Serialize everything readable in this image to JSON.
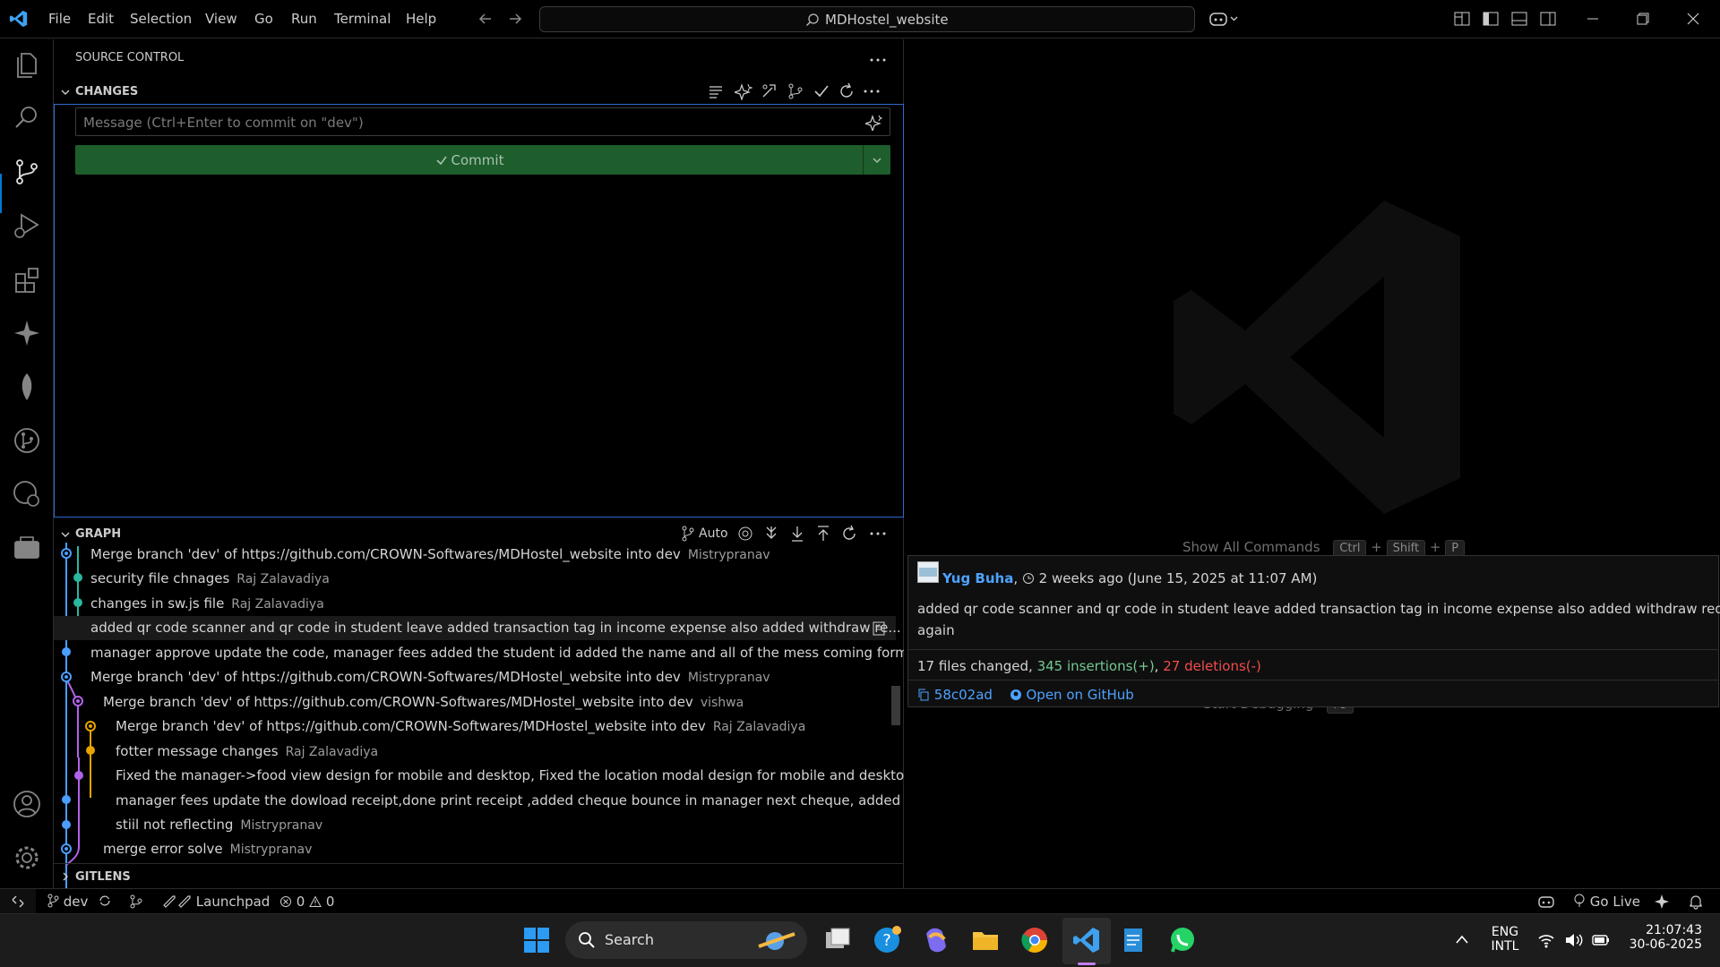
{
  "menu": [
    "File",
    "Edit",
    "Selection",
    "View",
    "Go",
    "Run",
    "Terminal",
    "Help"
  ],
  "search": {
    "text": "MDHostel_website"
  },
  "sidebar": {
    "title": "SOURCE CONTROL",
    "changes_label": "CHANGES",
    "commit_placeholder": "Message (Ctrl+Enter to commit on \"dev\")",
    "commit_label": "Commit",
    "graph_label": "GRAPH",
    "graph_mode": "Auto",
    "gitlens_label": "GITLENS"
  },
  "graph_rows": [
    {
      "msg": "Merge branch 'dev' of https://github.com/CROWN-Softwares/MDHostel_website into dev",
      "author": "Mistrypranav"
    },
    {
      "msg": "security file chnages",
      "author": "Raj Zalavadiya"
    },
    {
      "msg": "changes in sw.js file",
      "author": "Raj Zalavadiya"
    },
    {
      "msg": "added qr code scanner and qr code in student leave added transaction tag in income expense also added withdraw re...",
      "author": ""
    },
    {
      "msg": "manager approve update the code, manager fees added the student id  added the name and all of the mess coming form ...",
      "author": ""
    },
    {
      "msg": "Merge branch 'dev' of https://github.com/CROWN-Softwares/MDHostel_website into dev",
      "author": "Mistrypranav"
    },
    {
      "msg": "Merge branch 'dev' of https://github.com/CROWN-Softwares/MDHostel_website into dev",
      "author": "vishwa"
    },
    {
      "msg": "Merge branch 'dev' of https://github.com/CROWN-Softwares/MDHostel_website into dev",
      "author": "Raj Zalavadiya"
    },
    {
      "msg": "fotter message changes",
      "author": "Raj Zalavadiya"
    },
    {
      "msg": "Fixed the manager->food view design for mobile and desktop, Fixed the location modal design for mobile and deskto...",
      "author": ""
    },
    {
      "msg": "manager fees update the dowload receipt,done print receipt ,added cheque bounce in manager next cheque, added p...",
      "author": ""
    },
    {
      "msg": "stiil not reflecting",
      "author": "Mistrypranav"
    },
    {
      "msg": "merge error solve",
      "author": "Mistrypranav"
    }
  ],
  "editor": {
    "show_all_commands": "Show All Commands",
    "keys": [
      "Ctrl",
      "+",
      "Shift",
      "+",
      "P"
    ],
    "start_debugging": "Start Debugging",
    "debug_key": "F5"
  },
  "hovercard": {
    "author": "Yug Buha",
    "time": "2 weeks ago (June 15, 2025 at 11:07 AM)",
    "message_line1": "added qr code scanner and qr code in student leave added transaction tag in income expense also added withdraw request button",
    "message_line2": "again",
    "files_changed": "17 files changed,",
    "insertions": "345 insertions(+)",
    "deletions": "27 deletions(-)",
    "sha": "58c02ad",
    "open_github": "Open on GitHub"
  },
  "statusbar": {
    "branch": "dev",
    "launchpad": "Launchpad",
    "errors": "0",
    "warnings": "0",
    "go_live": "Go Live"
  },
  "taskbar": {
    "search": "Search",
    "lang1": "ENG",
    "lang2": "INTL",
    "time": "21:07:43",
    "date": "30-06-2025"
  },
  "colors": {
    "accent": "#0078d4",
    "commit_green": "#1d5e2c",
    "insert_green": "#73c991",
    "delete_red": "#f14c4c"
  }
}
